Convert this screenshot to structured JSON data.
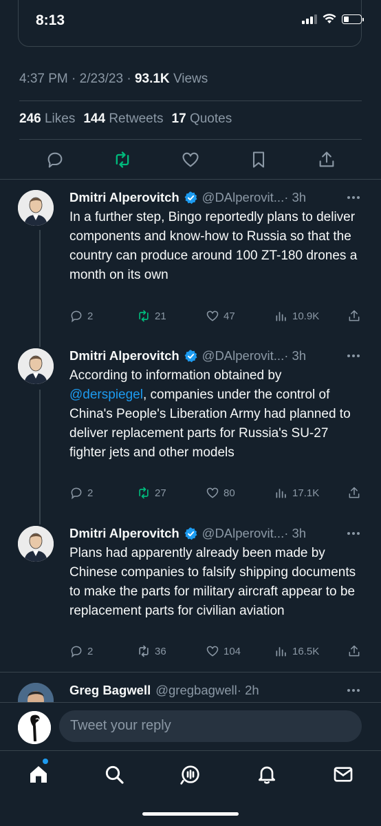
{
  "status_bar": {
    "time": "8:13"
  },
  "tweet_meta": {
    "time": "4:37 PM",
    "sep1": " · ",
    "date": "2/23/23",
    "sep2": " · ",
    "views_count": "93.1K",
    "views_label": "Views"
  },
  "tweet_stats": [
    {
      "count": "246",
      "label": "Likes"
    },
    {
      "count": "144",
      "label": "Retweets"
    },
    {
      "count": "17",
      "label": "Quotes"
    }
  ],
  "replies": [
    {
      "name": "Dmitri Alperovitch",
      "handle": "@DAlperovit...",
      "time": "· 3h",
      "text": "In a further step, Bingo reportedly plans to deliver components and know-how to Russia so that the country can produce around 100 ZT-180 drones a month on its own",
      "replies": "2",
      "retweets": "21",
      "likes": "47",
      "views": "10.9K"
    },
    {
      "name": "Dmitri Alperovitch",
      "handle": "@DAlperovit...",
      "time": "· 3h",
      "text_before": "According to information obtained by",
      "mention": "@derspiegel",
      "text_after": ", companies under the control of China's People's Liberation Army had planned to deliver replacement parts for Russia's SU-27 fighter jets and other models",
      "replies": "2",
      "retweets": "27",
      "likes": "80",
      "views": "17.1K"
    },
    {
      "name": "Dmitri Alperovitch",
      "handle": "@DAlperovit...",
      "time": "· 3h",
      "text": "Plans had apparently already been made by Chinese companies to falsify shipping documents to make the parts for military aircraft appear to be replacement parts for civilian aviation",
      "replies": "2",
      "retweets": "36",
      "likes": "104",
      "views": "16.5K"
    },
    {
      "name": "Greg Bagwell",
      "handle": "@gregbagwell",
      "time": "· 2h"
    }
  ],
  "composer": {
    "placeholder": "Tweet your reply"
  },
  "colors": {
    "background": "#15202b",
    "accent": "#1d9bf0",
    "retweet": "#00ba7c",
    "muted": "#8b98a5"
  }
}
